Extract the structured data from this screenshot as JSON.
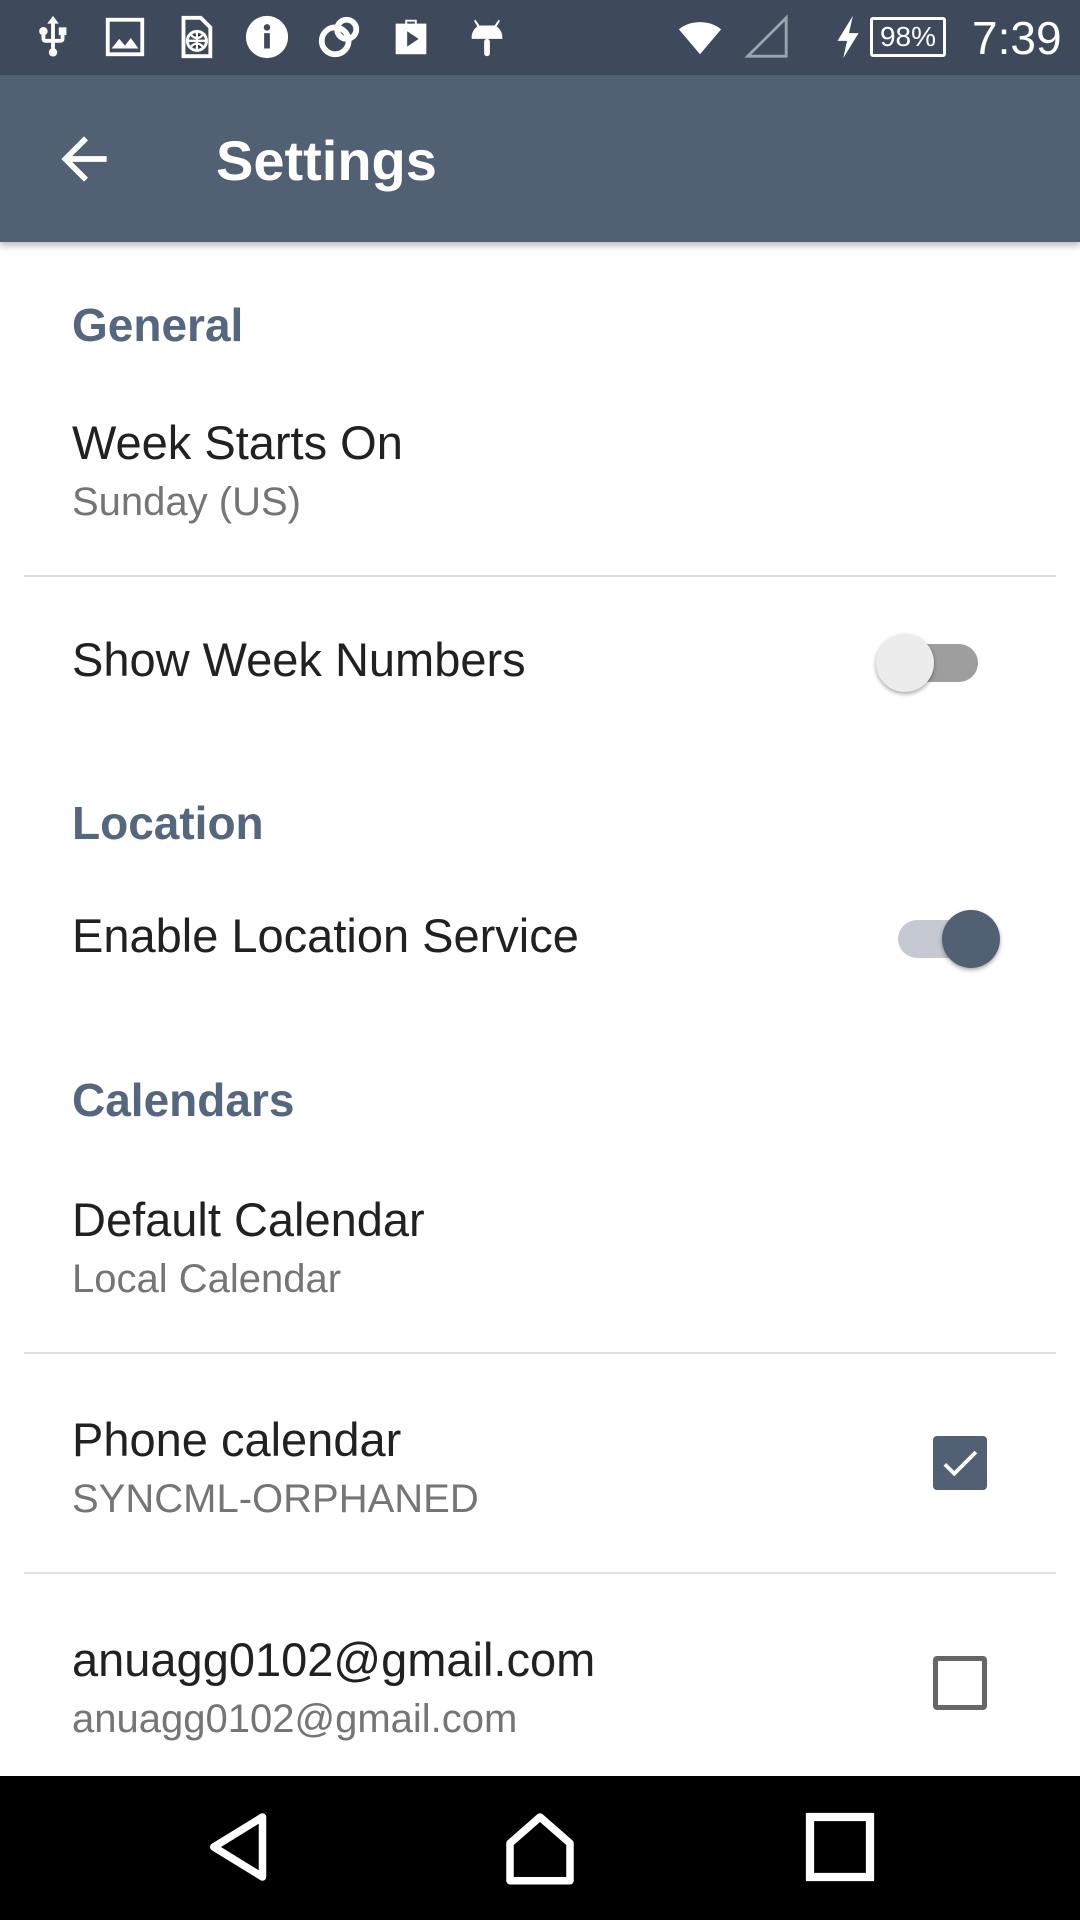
{
  "status_bar": {
    "battery_level": "98%",
    "time": "7:39",
    "left_icons": [
      "usb-icon",
      "image-icon",
      "sim-globe-icon",
      "info-icon",
      "sync-icon",
      "briefcase-play-icon",
      "android-icon"
    ],
    "right_icons": [
      "wifi-icon",
      "signal-icon",
      "charging-icon",
      "battery-icon"
    ]
  },
  "app_bar": {
    "title": "Settings",
    "back_icon": "arrow-back-icon"
  },
  "sections": {
    "general": {
      "header": "General",
      "week_starts_on": {
        "title": "Week Starts On",
        "summary": "Sunday (US)"
      },
      "show_week_numbers": {
        "title": "Show Week Numbers",
        "enabled": false
      }
    },
    "location": {
      "header": "Location",
      "enable_location_service": {
        "title": "Enable Location Service",
        "enabled": true
      }
    },
    "calendars": {
      "header": "Calendars",
      "default_calendar": {
        "title": "Default Calendar",
        "summary": "Local Calendar"
      },
      "phone_calendar": {
        "title": "Phone calendar",
        "summary": "SYNCML-ORPHANED",
        "checked": true
      },
      "gmail_calendar": {
        "title": "anuagg0102@gmail.com",
        "summary": "anuagg0102@gmail.com",
        "checked": false
      }
    }
  },
  "nav_bar": {
    "back": "nav-back-icon",
    "home": "nav-home-icon",
    "recents": "nav-recents-icon"
  },
  "colors": {
    "status_bar": "#3e4a5b",
    "app_bar": "#526074",
    "accent": "#526074",
    "section_header": "#55667f",
    "switch_off_track": "#9e9e9e",
    "switch_off_thumb": "#ececec",
    "switch_on_track": "#c5cad2",
    "nav_bar": "#000000"
  }
}
